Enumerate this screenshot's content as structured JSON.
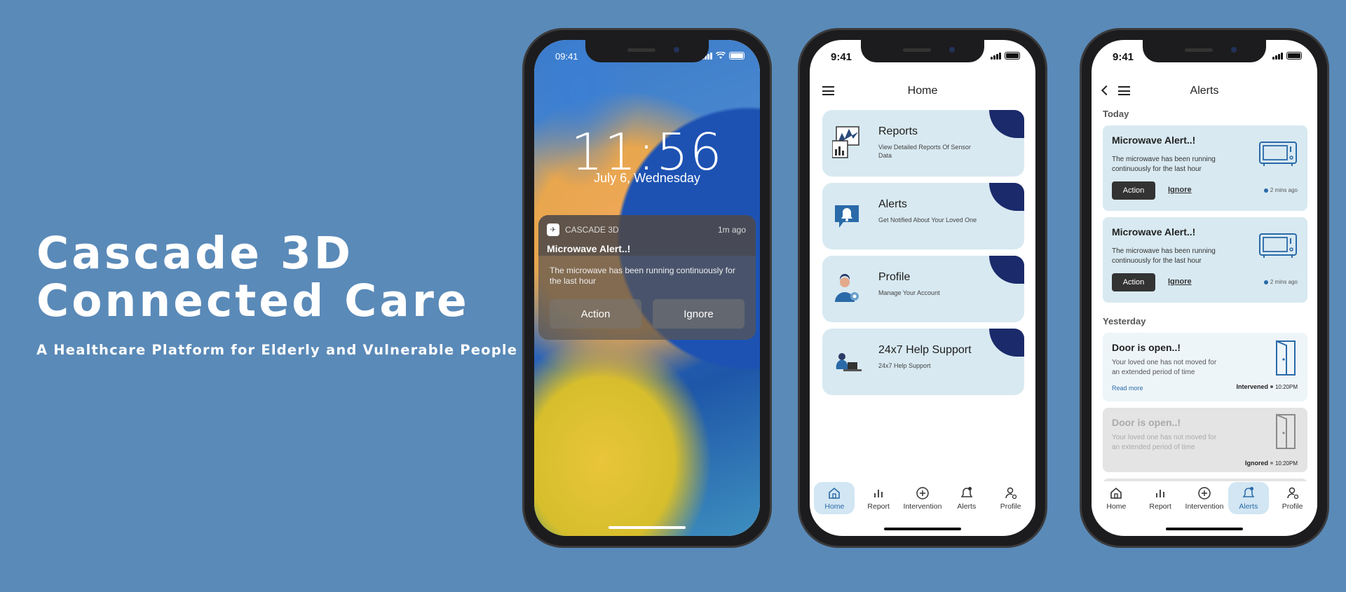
{
  "hero": {
    "title_line1": "Cascade 3D",
    "title_line2": "Connected Care",
    "subtitle": "A Healthcare Platform for Elderly and Vulnerable People"
  },
  "lock_screen": {
    "status_time": "09:41",
    "clock": "11:56",
    "date": "July 6, Wednesday",
    "notification": {
      "app_name": "CASCADE 3D",
      "time_ago": "1m ago",
      "title": "Microwave Alert..!",
      "body": "The microwave has been running continuously for the last hour",
      "action_label": "Action",
      "ignore_label": "Ignore"
    }
  },
  "home_screen": {
    "status_time": "9:41",
    "title": "Home",
    "cards": [
      {
        "title": "Reports",
        "subtitle": "View Detailed Reports Of Sensor Data"
      },
      {
        "title": "Alerts",
        "subtitle": "Get Notified About Your Loved One"
      },
      {
        "title": "Profile",
        "subtitle": "Manage Your Account"
      },
      {
        "title": "24x7 Help Support",
        "subtitle": "24x7 Help Support"
      }
    ]
  },
  "alerts_screen": {
    "status_time": "9:41",
    "title": "Alerts",
    "today_label": "Today",
    "yesterday_label": "Yesterday",
    "today": [
      {
        "title": "Microwave Alert..!",
        "body": "The microwave has been running continuously for the last hour",
        "action_label": "Action",
        "ignore_label": "Ignore",
        "time_ago": "2 mins ago"
      },
      {
        "title": "Microwave Alert..!",
        "body": "The microwave has been running continuously for the last hour",
        "action_label": "Action",
        "ignore_label": "Ignore",
        "time_ago": "2 mins ago"
      }
    ],
    "yesterday": [
      {
        "title": "Door is open..!",
        "body": "Your loved one has not moved for an extended period of time",
        "read_more": "Read more",
        "status": "Intervened",
        "time": "10:20PM"
      },
      {
        "title": "Door is open..!",
        "body": "Your loved one has not moved for an extended period of time",
        "status": "Ignored",
        "time": "10:20PM"
      }
    ]
  },
  "tabbar": {
    "home": "Home",
    "report": "Report",
    "intervention": "Intervention",
    "alerts": "Alerts",
    "profile": "Profile"
  },
  "colors": {
    "background": "#5a8ab8",
    "card": "#d8e9f1",
    "accent_dark": "#1b2a6b",
    "active_tab": "#d2e6f3"
  }
}
